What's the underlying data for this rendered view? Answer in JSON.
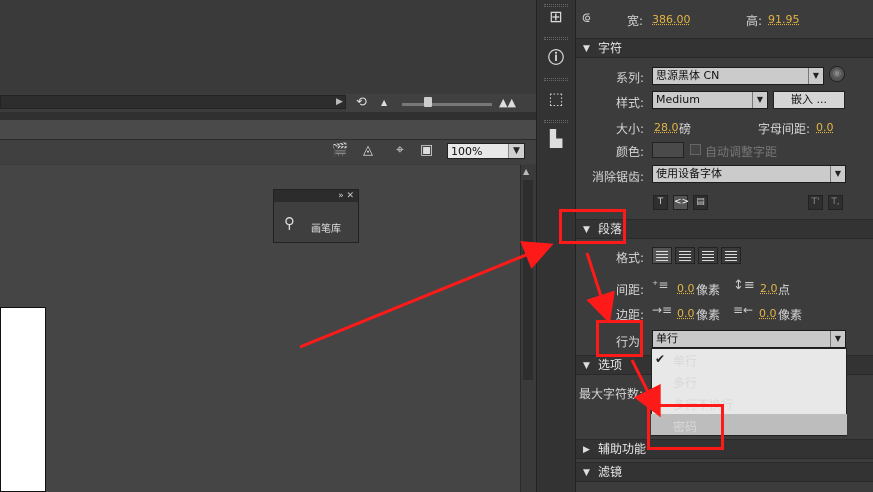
{
  "stage": {
    "zoom": "100%",
    "brush_library_label": "画笔库"
  },
  "props": {
    "width_label": "宽:",
    "width_value": "386.00",
    "height_label": "高:",
    "height_value": "91.95",
    "character": {
      "title": "字符",
      "family_label": "系列:",
      "family_value": "思源黑体 CN",
      "style_label": "样式:",
      "style_value": "Medium",
      "embed_label": "嵌入 ...",
      "size_label": "大小:",
      "size_value": "28.0",
      "size_unit": "磅",
      "tracking_label": "字母间距:",
      "tracking_value": "0.0",
      "color_label": "颜色:",
      "auto_kern_label": "自动调整字距",
      "antialias_label": "消除锯齿:",
      "antialias_value": "使用设备字体"
    },
    "paragraph": {
      "title": "段落",
      "format_label": "格式:",
      "spacing_label": "间距:",
      "indent_value": "0.0",
      "indent_unit": "像素",
      "line_spacing_value": "2.0",
      "line_spacing_unit": "点",
      "margin_label": "边距:",
      "left_margin_value": "0.0",
      "left_margin_unit": "像素",
      "right_margin_value": "0.0",
      "right_margin_unit": "像素",
      "behavior_label": "行为",
      "behavior_value": "单行"
    },
    "options": {
      "title": "选项",
      "max_chars_label": "最大字符数:"
    },
    "accessibility_title": "辅助功能",
    "filters_title": "滤镜"
  },
  "behavior_menu": {
    "items": [
      "单行",
      "多行",
      "多行不换行",
      "密码"
    ],
    "selected": "单行",
    "highlighted": "密码"
  },
  "colors": {
    "accent_value": "#e2b445",
    "annotation": "#ff1a1a"
  }
}
